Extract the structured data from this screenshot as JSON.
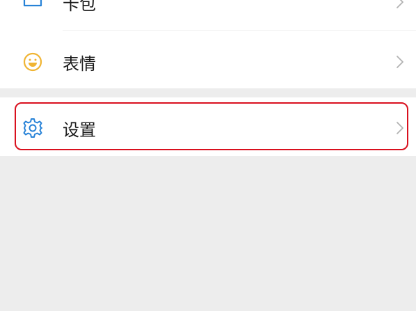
{
  "menu": {
    "items": [
      {
        "label": "卡包",
        "icon": "card-wallet-icon",
        "color": "#2782d7"
      },
      {
        "label": "表情",
        "icon": "smiley-face-icon",
        "color": "#f0b432"
      },
      {
        "label": "设置",
        "icon": "gear-icon",
        "color": "#2782d7"
      }
    ]
  },
  "highlight": {
    "target": "设置",
    "color": "#d9101e"
  },
  "colors": {
    "background": "#ededed",
    "row_background": "#ffffff",
    "text": "#191919",
    "chevron": "#b2b2b2"
  }
}
